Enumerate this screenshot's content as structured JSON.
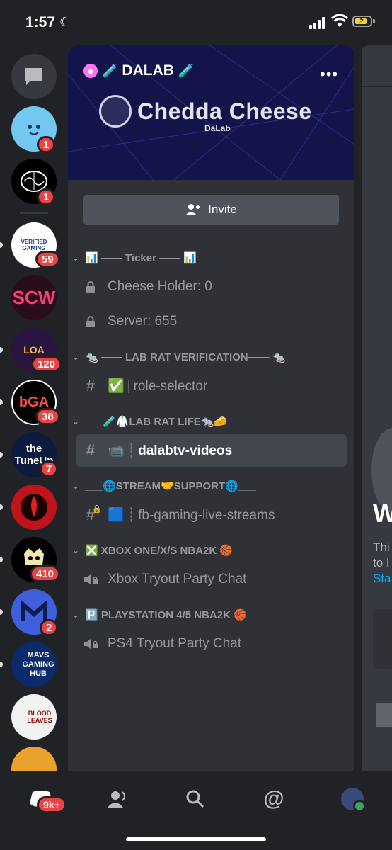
{
  "status_bar": {
    "time": "1:57"
  },
  "rail": {
    "servers": [
      {
        "name": "direct-messages",
        "badge": ""
      },
      {
        "name": "server-1",
        "badge": "1"
      },
      {
        "name": "server-2",
        "badge": "1"
      },
      {
        "name": "verified-gaming",
        "label": "VERIFIED GAMING",
        "badge": "59"
      },
      {
        "name": "scw",
        "label": "SCW",
        "badge": ""
      },
      {
        "name": "loa",
        "label": "LOA",
        "badge": "120"
      },
      {
        "name": "bga",
        "label": "bGA",
        "badge": "38"
      },
      {
        "name": "tuneup",
        "label": "the TuneUp",
        "badge": "7"
      },
      {
        "name": "server-9",
        "badge": ""
      },
      {
        "name": "server-10",
        "badge": "410"
      },
      {
        "name": "server-11",
        "badge": "2"
      },
      {
        "name": "mavs-gaming-hub",
        "label": "MAVS GAMING HUB",
        "badge": ""
      },
      {
        "name": "blood-leaves",
        "label": "BLOOD LEAVES",
        "badge": ""
      }
    ]
  },
  "panel": {
    "server_name": "DALAB",
    "banner_title": "Chedda Cheese",
    "banner_subtitle": "DaLab",
    "invite_label": "Invite",
    "categories": [
      {
        "label": "📊 —— Ticker —— 📊",
        "channels": [
          {
            "type": "locked",
            "name": "Cheese Holder: 0"
          },
          {
            "type": "locked",
            "name": "Server: 655"
          }
        ]
      },
      {
        "label": "🐀 —— LAB RAT VERIFICATION—— 🐀",
        "channels": [
          {
            "type": "text",
            "emoji": "✅",
            "name": "role-selector"
          }
        ]
      },
      {
        "label": "___🧪🥼LAB RAT LIFE🐀🧀___",
        "channels": [
          {
            "type": "text",
            "emoji": "📹",
            "name": "dalabtv-videos",
            "active": true
          }
        ]
      },
      {
        "label": "___🌐STREAM🤝SUPPORT🌐___",
        "channels": [
          {
            "type": "text-locked",
            "emoji": "🟦",
            "name": "fb-gaming-live-streams"
          }
        ]
      },
      {
        "label": "❎ XBOX ONE/X/S  NBA2K 🏀",
        "channels": [
          {
            "type": "voice",
            "name": "Xbox Tryout Party Chat"
          }
        ]
      },
      {
        "label": "🅿️ PLAYSTATION 4/5 NBA2K 🏀",
        "channels": [
          {
            "type": "voice",
            "name": "PS4 Tryout Party Chat"
          }
        ]
      }
    ]
  },
  "peek": {
    "big": "W",
    "line1": "Thi",
    "line2": "to I",
    "link": "Sta"
  },
  "bottom_nav": {
    "home_badge": "9k+"
  },
  "colors": {
    "accent": "#5865f2",
    "badge": "#ed4245",
    "panel": "#2f3136",
    "rail": "#202225"
  }
}
